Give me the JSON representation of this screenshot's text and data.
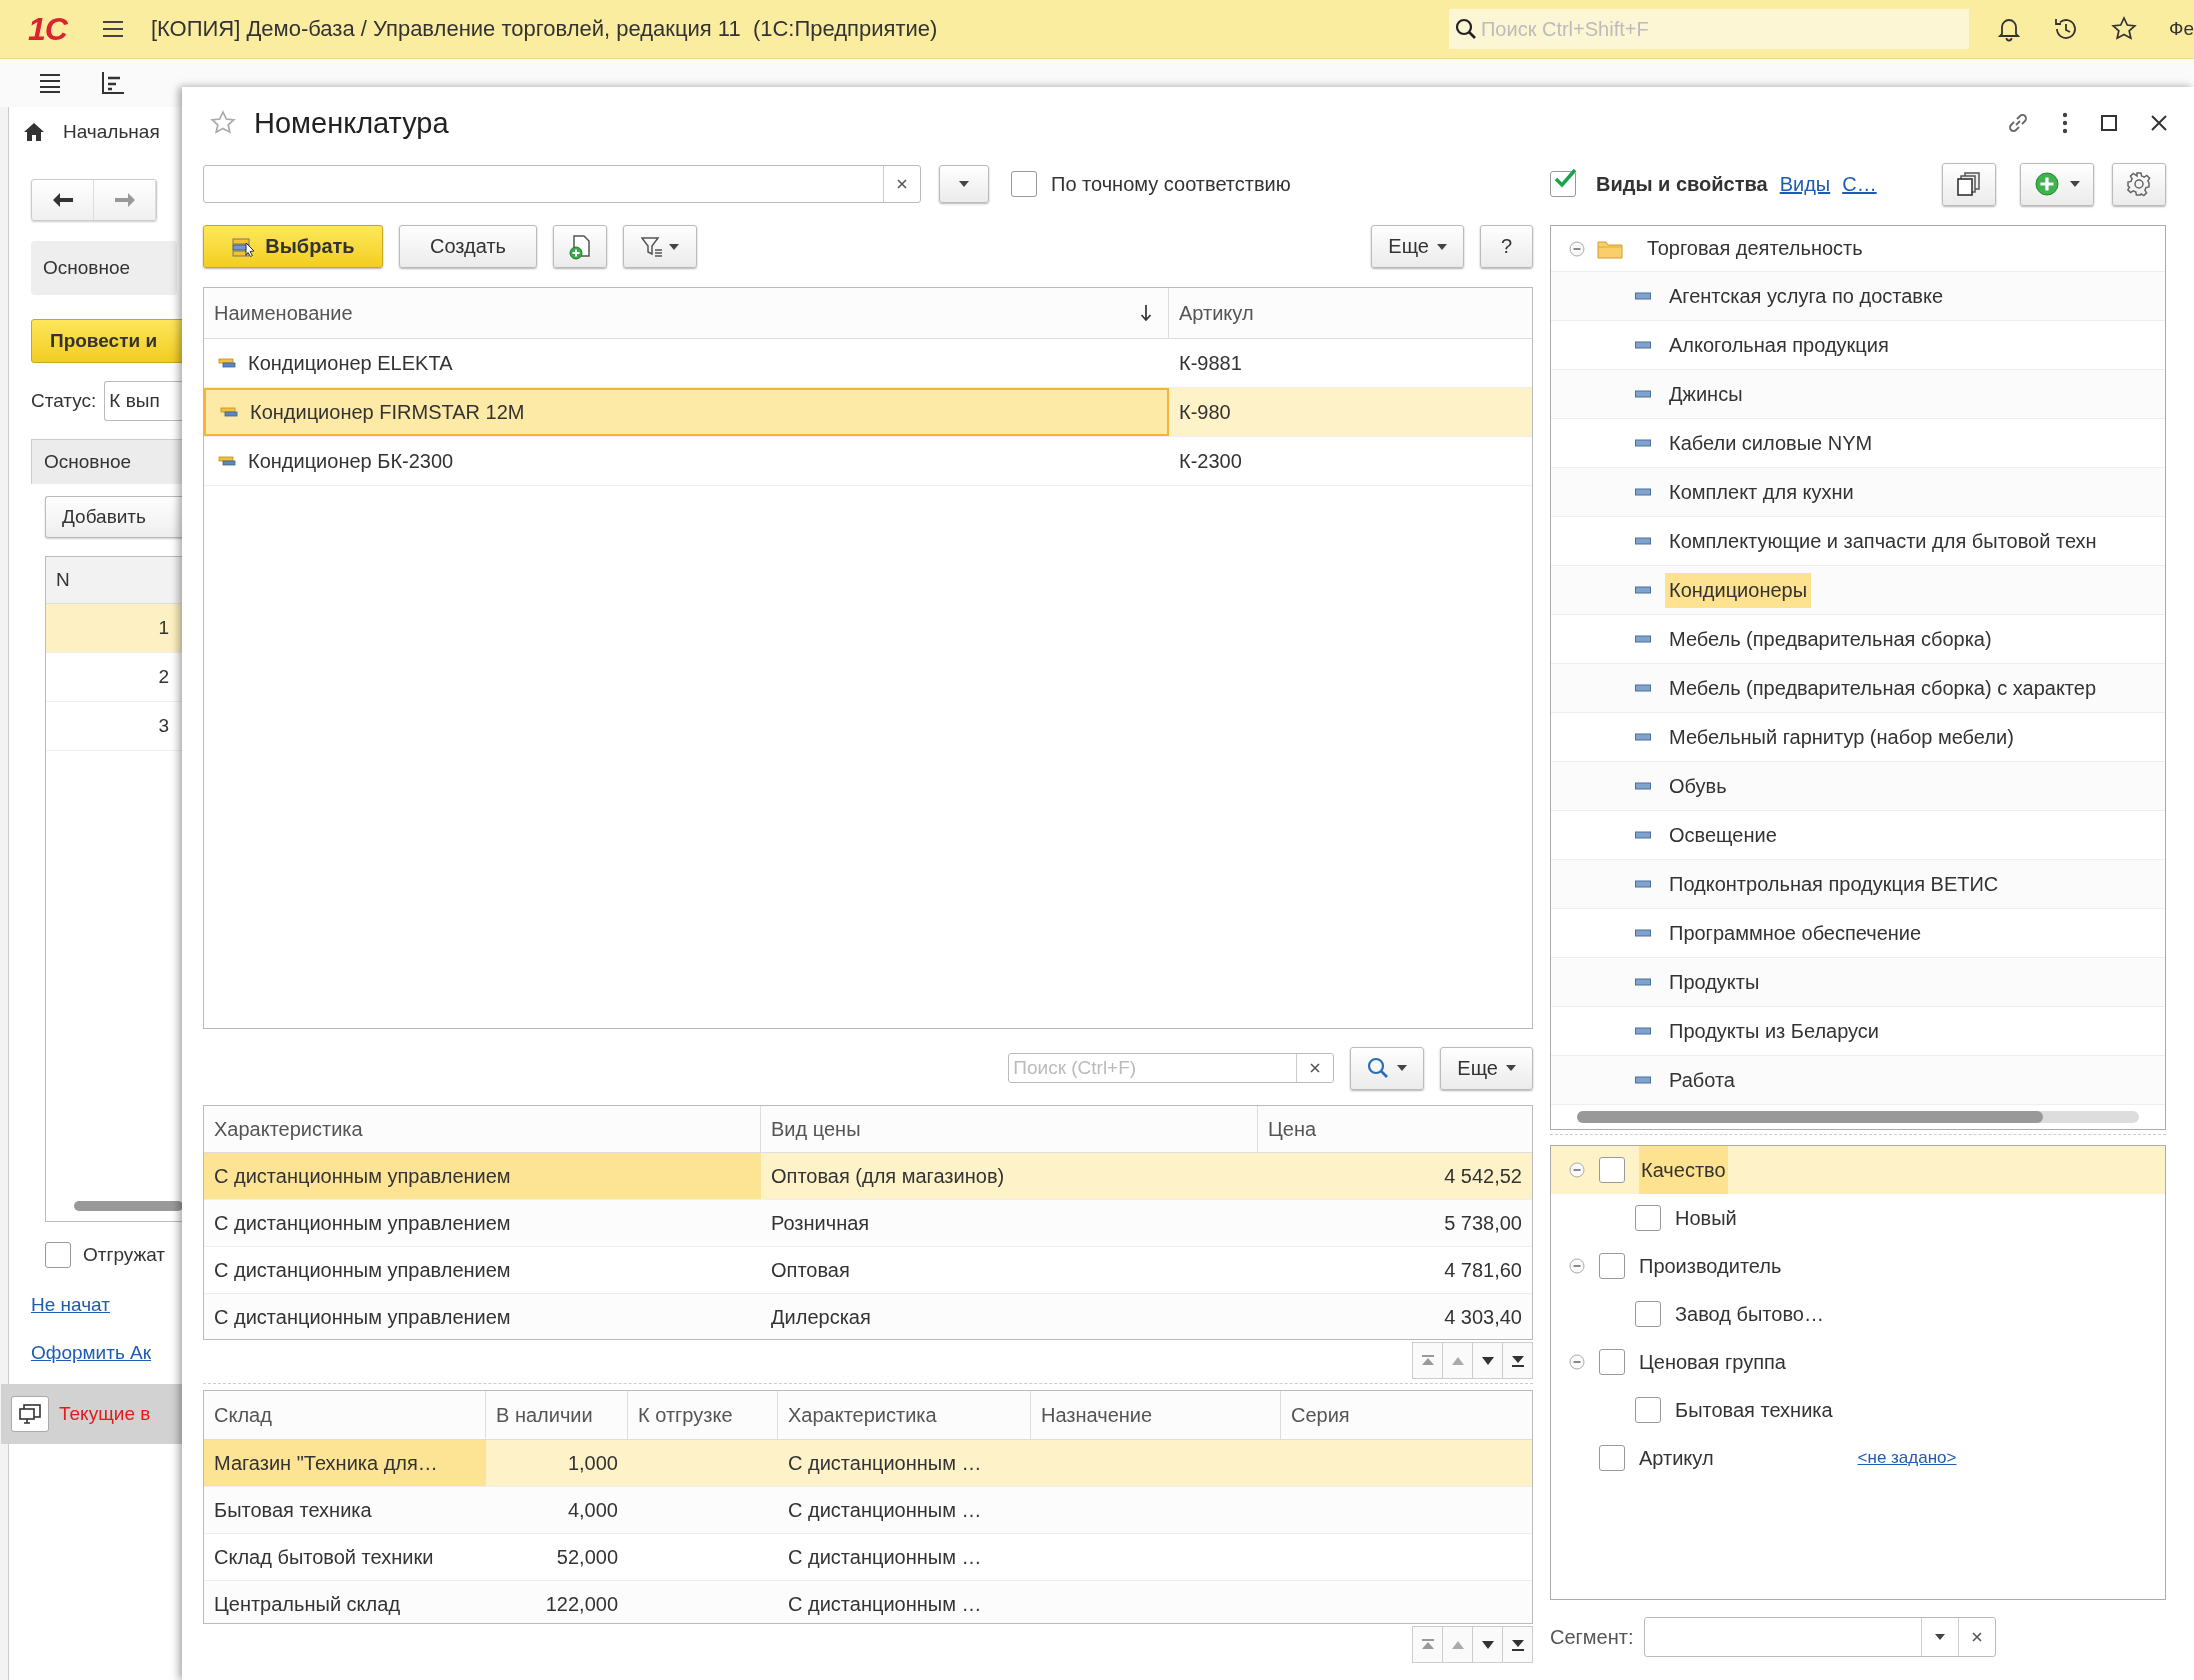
{
  "app": {
    "logo": "1С",
    "title": "[КОПИЯ] Демо-база / Управление торговлей, редакция 11  (1С:Предприятие)",
    "search_placeholder": "Поиск Ctrl+Shift+F",
    "user": "Фе"
  },
  "background_form": {
    "home_tab": "Начальная",
    "section_tab": "Основное",
    "post_button": "Провести и",
    "status_label": "Статус:",
    "status_value": "К вып",
    "page_tab": "Основное",
    "add_button": "Добавить",
    "table": {
      "columns": [
        "N"
      ],
      "rows": [
        {
          "n": "1",
          "selected": true
        },
        {
          "n": "2",
          "selected": false
        },
        {
          "n": "3",
          "selected": false
        }
      ]
    },
    "ship_checkbox": {
      "label": "Отгружат",
      "checked": false
    },
    "status_link": "Не начат",
    "act_link": "Оформить Ак",
    "taskbar_item": "Текущие в"
  },
  "dialog": {
    "title": "Номенклатура",
    "favorite": false,
    "exact_match": {
      "label": "По точному соответствию",
      "checked": false
    },
    "toolbar": {
      "select_button": "Выбрать",
      "create_button": "Создать",
      "more_button": "Еще",
      "help_button": "?"
    },
    "items_table": {
      "columns": [
        "Наименование",
        "Артикул"
      ],
      "rows": [
        {
          "name": "Кондиционер ELEKTA",
          "article": "К-9881",
          "selected": false
        },
        {
          "name": "Кондиционер FIRMSTAR 12M",
          "article": "К-980",
          "selected": true
        },
        {
          "name": "Кондиционер БК-2300",
          "article": "К-2300",
          "selected": false
        }
      ]
    },
    "list_search": {
      "placeholder": "Поиск (Ctrl+F)",
      "more_button": "Еще"
    },
    "prices_table": {
      "columns": [
        "Характеристика",
        "Вид цены",
        "Цена"
      ],
      "rows": [
        {
          "characteristic": "С дистанционным управлением",
          "price_type": "Оптовая (для магазинов)",
          "price": "4 542,52",
          "selected": true
        },
        {
          "characteristic": "С дистанционным управлением",
          "price_type": "Розничная",
          "price": "5 738,00",
          "selected": false
        },
        {
          "characteristic": "С дистанционным управлением",
          "price_type": "Оптовая",
          "price": "4 781,60",
          "selected": false
        },
        {
          "characteristic": "С дистанционным управлением",
          "price_type": "Дилерская",
          "price": "4 303,40",
          "selected": false
        }
      ]
    },
    "stock_table": {
      "columns": [
        "Склад",
        "В наличии",
        "К отгрузке",
        "Характеристика",
        "Назначение",
        "Серия"
      ],
      "rows": [
        {
          "warehouse": "Магазин \"Техника для…",
          "available": "1,000",
          "characteristic": "С дистанционным …",
          "selected": true
        },
        {
          "warehouse": "Бытовая техника",
          "available": "4,000",
          "characteristic": "С дистанционным …",
          "selected": false
        },
        {
          "warehouse": "Склад бытовой техники",
          "available": "52,000",
          "characteristic": "С дистанционным …",
          "selected": false
        },
        {
          "warehouse": "Центральный склад",
          "available": "122,000",
          "characteristic": "С дистанционным …",
          "selected": false
        }
      ]
    },
    "kinds_panel": {
      "enabled": {
        "label": "Виды и свойства",
        "checked": true
      },
      "links": [
        "Виды",
        "С…"
      ],
      "tree": {
        "label": "Торговая деятельность",
        "expanded": true,
        "children": [
          {
            "label": "Агентская услуга по доставке",
            "selected": false
          },
          {
            "label": "Алкогольная продукция",
            "selected": false
          },
          {
            "label": "Джинсы",
            "selected": false
          },
          {
            "label": "Кабели силовые NYM",
            "selected": false
          },
          {
            "label": "Комплект для кухни",
            "selected": false
          },
          {
            "label": "Комплектующие и запчасти для бытовой техн",
            "selected": false
          },
          {
            "label": "Кондиционеры",
            "selected": true
          },
          {
            "label": "Мебель (предварительная сборка)",
            "selected": false
          },
          {
            "label": "Мебель (предварительная сборка) с характер",
            "selected": false
          },
          {
            "label": "Мебельный гарнитур (набор мебели)",
            "selected": false
          },
          {
            "label": "Обувь",
            "selected": false
          },
          {
            "label": "Освещение",
            "selected": false
          },
          {
            "label": "Подконтрольная продукция ВЕТИС",
            "selected": false
          },
          {
            "label": "Программное обеспечение",
            "selected": false
          },
          {
            "label": "Продукты",
            "selected": false
          },
          {
            "label": "Продукты из Беларуси",
            "selected": false
          },
          {
            "label": "Работа",
            "selected": false
          }
        ]
      }
    },
    "properties": [
      {
        "label": "Качество",
        "checked": false,
        "expanded": true,
        "selected": true,
        "children": [
          {
            "label": "Новый",
            "checked": false,
            "selected": false
          }
        ]
      },
      {
        "label": "Производитель",
        "checked": false,
        "expanded": true,
        "selected": false,
        "children": [
          {
            "label": "Завод бытово…",
            "checked": false,
            "selected": false
          }
        ]
      },
      {
        "label": "Ценовая группа",
        "checked": false,
        "expanded": true,
        "selected": false,
        "children": [
          {
            "label": "Бытовая техника",
            "checked": false,
            "selected": false
          }
        ]
      },
      {
        "label": "Артикул",
        "checked": false,
        "selected": false,
        "value": "<не задано>"
      }
    ],
    "segment": {
      "label": "Сегмент:"
    }
  }
}
